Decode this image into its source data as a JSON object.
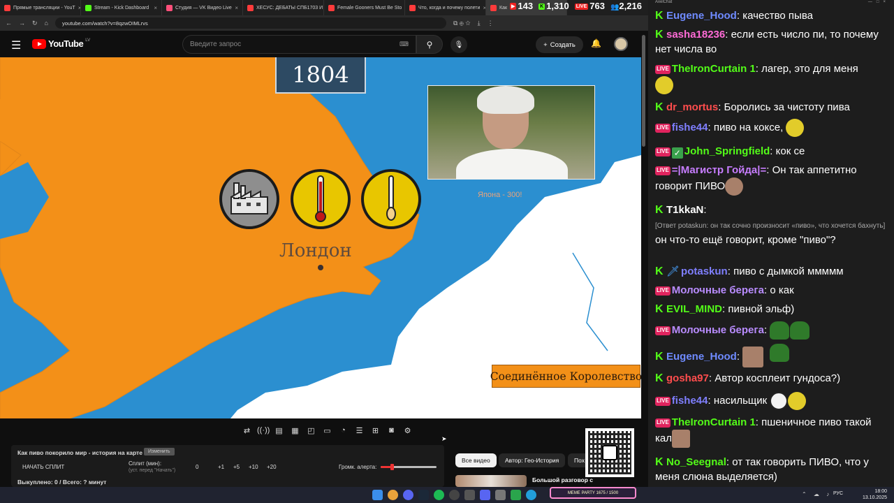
{
  "browser": {
    "tabs": [
      {
        "title": "Прямые трансляции - YouT",
        "color": "#ff3b3b"
      },
      {
        "title": "Stream - Kick Dashboard",
        "color": "#53fc18"
      },
      {
        "title": "Студия — VK Видео Live",
        "color": "#ff4f7a"
      },
      {
        "title": "ХЕСУС: ДЕБАТЫ СПБ1703 И",
        "color": "#ff3b3b"
      },
      {
        "title": "Female Gooners Must Be Sto",
        "color": "#ff3b3b"
      },
      {
        "title": "Что, когда и почему полети",
        "color": "#ff3b3b"
      },
      {
        "title": "Как",
        "color": "#ff3b3b"
      }
    ],
    "url": "youtube.com/watch?v=8qzwOIMLrvs"
  },
  "youtube": {
    "logo_text": "YouTube",
    "logo_region": "LV",
    "search_placeholder": "Введите запрос",
    "create_label": "Создать"
  },
  "video": {
    "year": "1804",
    "city_label": "Лондон",
    "country_label": "Соединённое Королевство",
    "japan_label": "Япона - 300!",
    "colors": {
      "sea": "#2b8fd0",
      "land_britain": "#f39018",
      "land_europe": "#ffffff"
    }
  },
  "split": {
    "title": "Как пиво покорило мир - история на карте",
    "badge": "Изменить",
    "start_label": "НАЧАТЬ СПЛИТ",
    "split_min_label": "Сплит (мин):",
    "split_hint": "(уст. перед \"Начать\")",
    "value": "0",
    "steps": [
      "+1",
      "+5",
      "+10",
      "+20"
    ],
    "volume_label": "Громк. алерта:",
    "volume_level": 0.2,
    "bought": "Выкуплено: 0 / Всего: ? минут"
  },
  "chips": {
    "all": "Все видео",
    "author": "Автор: Гео-История",
    "more": "Пох"
  },
  "reco": {
    "title": "Большой разговор с"
  },
  "meme_pill": "MEME PARTY 1675 / 1500",
  "stats": {
    "youtube": "143",
    "kick": "1,310",
    "vk": "763",
    "total": "2,216"
  },
  "chat_app": "AxelChat",
  "chat": [
    {
      "platform": "kick",
      "nick": "Eugene_Hood",
      "color": "#6f8bff",
      "text": "качество пыва"
    },
    {
      "platform": "kick",
      "nick": "sasha18236",
      "color": "#ff6bd6",
      "text": "если есть число пи, то почему нет числа во"
    },
    {
      "platform": "live",
      "nick": "TheIronCurtain 1",
      "color": "#53fc18",
      "text": "лагер, это для меня"
    },
    {
      "platform": "kick",
      "nick": "dr_mortus",
      "color": "#ff4d4d",
      "text": "Боролись за чистоту пива"
    },
    {
      "platform": "live",
      "nick": "fishe44",
      "color": "#7f7fff",
      "text": "пиво на коксе,"
    },
    {
      "platform": "live",
      "nick": "John_Springfield",
      "color": "#53fc18",
      "text": "кок се"
    },
    {
      "platform": "live",
      "nick": "=|Магистр Гойда|=",
      "color": "#c77dff",
      "text": "Он так аппетитно говорит ПИВО"
    },
    {
      "platform": "kick",
      "nick": "T1kkaN",
      "color": "#ffffff",
      "reply": "[Ответ potaskun: он так сочно произносит «пиво», что хочется бахнуть]",
      "text": "он что-то ещё говорит, кроме \"пиво\"?"
    },
    {
      "platform": "kick",
      "nick": "potaskun",
      "color": "#7f7fff",
      "text": "пиво с дымкой ммммм"
    },
    {
      "platform": "live",
      "nick": "Молочные берега",
      "color": "#b98cff",
      "text": "о как"
    },
    {
      "platform": "kick",
      "nick": "EVIL_MIND",
      "color": "#53fc18",
      "text": "пивной эльф)"
    },
    {
      "platform": "live",
      "nick": "Молочные берега",
      "color": "#b98cff",
      "text": ""
    },
    {
      "platform": "kick",
      "nick": "Eugene_Hood",
      "color": "#6f8bff",
      "text": ""
    },
    {
      "platform": "kick",
      "nick": "gosha97",
      "color": "#ff4d4d",
      "text": "Автор косплеит гундоса?)"
    },
    {
      "platform": "live",
      "nick": "fishe44",
      "color": "#7f7fff",
      "text": "насильщик"
    },
    {
      "platform": "live",
      "nick": "TheIronCurtain 1",
      "color": "#53fc18",
      "text": "пшеничное пиво такой кал"
    },
    {
      "platform": "kick",
      "nick": "No_Seegnal",
      "color": "#53fc18",
      "text": "от так говорить ПИВО, что у меня слюна выделяется)"
    }
  ],
  "tray": {
    "lang": "РУС",
    "time": "18:00",
    "date": "13.10.2025"
  }
}
